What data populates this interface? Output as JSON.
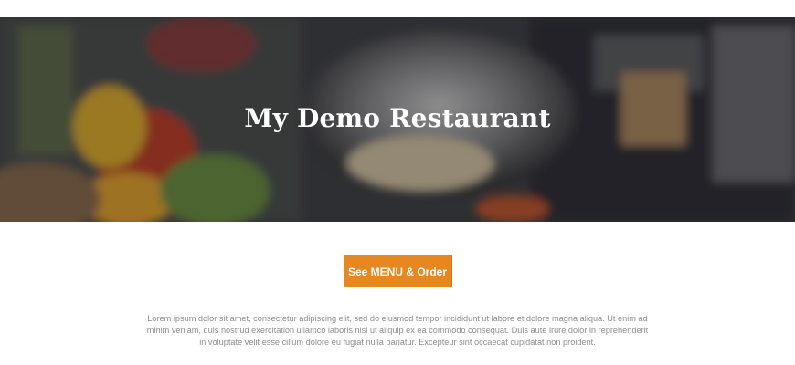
{
  "hero": {
    "title": "My Demo Restaurant"
  },
  "cta": {
    "label": "See MENU & Order"
  },
  "intro": {
    "text": "Lorem ipsum dolor sit amet, consectetur adipiscing elit, sed do eiusmod tempor incididunt ut labore et dolore magna aliqua. Ut enim ad minim veniam, quis nostrud exercitation ullamco laboris nisi ut aliquip ex ea commodo consequat. Duis aute irure dolor in reprehenderit in voluptate velit esse cillum dolore eu fugiat nulla pariatur. Excepteur sint occaecat cupidatat non proident."
  },
  "colors": {
    "button": "#e8861f",
    "text_muted": "#8e8e8e",
    "title": "#ffffff"
  }
}
